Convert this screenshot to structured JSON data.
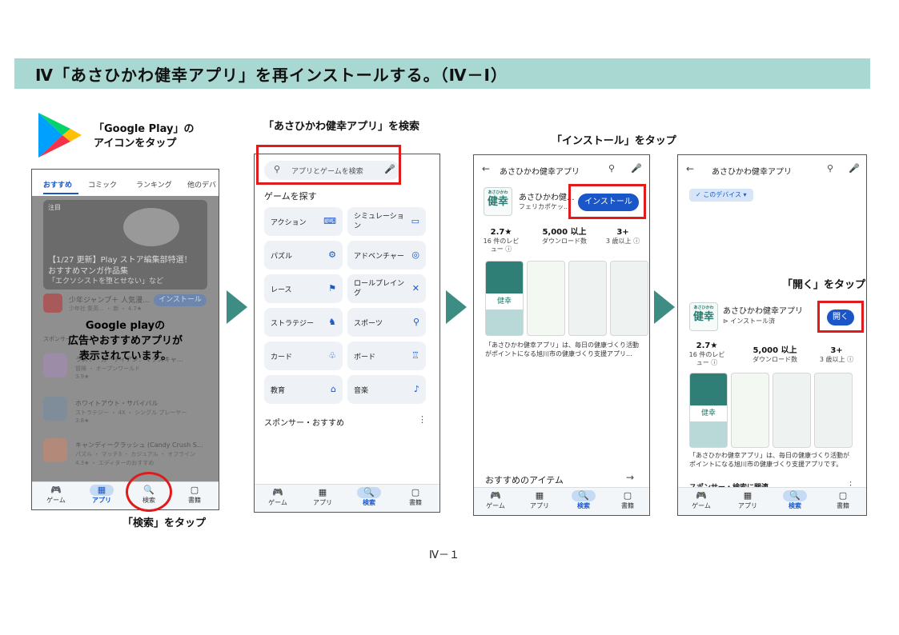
{
  "header": {
    "title": "Ⅳ「あさひかわ健幸アプリ」を再インストールする。（Ⅳ－Ⅰ）"
  },
  "captions": {
    "play_icon": "「Google Play」の",
    "play_icon2": "アイコンをタップ",
    "search_tap": "「検索」をタップ",
    "search_app": "「あさひかわ健幸アプリ」を検索",
    "install_tap": "「インストール」をタップ",
    "open_tap": "「開く」をタップ"
  },
  "colors": {
    "header_bg": "#a9d7d1",
    "arrow": "#3d8d85",
    "highlight": "#e01b1b",
    "primary": "#1a56c8"
  },
  "screen1": {
    "tabs": [
      "おすすめ",
      "コミック",
      "ランキング",
      "他のデバ"
    ],
    "overlay": [
      "Google playの",
      "広告やおすすめアプリが",
      "表示されています。"
    ],
    "featured_tag": "注目",
    "featured_title": "【1/27 更新】Play ストア編集部特選！",
    "featured_sub": "おすすめマンガ作品集",
    "featured_sub2": "「エクソシストを堕とせない」など",
    "row1_app": "少年ジャンプ＋ 人気漫...",
    "row1_meta": "少年社 集英... ・ 新 ・ 4.7★",
    "row1_btn": "インストール",
    "section": "スポンサー",
    "apps": [
      {
        "name": "ラスト・ガーディアン：マクスキャ...",
        "meta": "冒険 ・ オープンワールド",
        "rating": "3.9★"
      },
      {
        "name": "ホワイトアウト・サバイバル",
        "meta": "ストラテジー ・ 4X ・ シングル プレーヤー",
        "rating": "3.8★"
      },
      {
        "name": "キャンディークラッシュ (Candy Crush S...",
        "meta": "パズル ・ マッチ3 ・ カジュアル ・ オフライン",
        "rating": "4.3★ ・ エディターのおすすめ"
      }
    ],
    "nav": [
      {
        "icon": "🎮",
        "label": "ゲーム"
      },
      {
        "icon": "▦",
        "label": "アプリ"
      },
      {
        "icon": "🔍",
        "label": "検索"
      },
      {
        "icon": "▢",
        "label": "書籍"
      }
    ]
  },
  "screen2": {
    "search_placeholder": "アプリとゲームを検索",
    "section_title": "ゲームを探す",
    "categories": [
      {
        "label": "アクション",
        "icon": "⌨"
      },
      {
        "label": "シミュレーション",
        "icon": "▭"
      },
      {
        "label": "パズル",
        "icon": "⚙"
      },
      {
        "label": "アドベンチャー",
        "icon": "◎"
      },
      {
        "label": "レース",
        "icon": "⚑"
      },
      {
        "label": "ロールプレイング",
        "icon": "✕"
      },
      {
        "label": "ストラテジー",
        "icon": "♞"
      },
      {
        "label": "スポーツ",
        "icon": "⚲"
      },
      {
        "label": "カード",
        "icon": "♧"
      },
      {
        "label": "ボード",
        "icon": "♖"
      },
      {
        "label": "教育",
        "icon": "⌂"
      },
      {
        "label": "音楽",
        "icon": "♪"
      }
    ],
    "sponsored": "スポンサー・おすすめ",
    "nav": [
      {
        "icon": "🎮",
        "label": "ゲーム"
      },
      {
        "icon": "▦",
        "label": "アプリ"
      },
      {
        "icon": "🔍",
        "label": "検索"
      },
      {
        "icon": "▢",
        "label": "書籍"
      }
    ]
  },
  "screen3": {
    "title": "あさひかわ健幸アプリ",
    "app_name": "あさひかわ健...",
    "developer": "フェリカポケッ...",
    "install": "インストール",
    "rating": "2.7★",
    "reviews": "16 件のレビュー ⓘ",
    "downloads": "5,000 以上",
    "downloads_label": "ダウンロード数",
    "age": "3+",
    "age_label": "3 歳以上 ⓘ",
    "logo_small": "あさひかわ",
    "logo_big": "健幸",
    "shot_text": "健幸",
    "description": "「あさひかわ健幸アプリ」は、毎日の健康づくり活動がポイントになる旭川市の健康づくり支援アプリ...",
    "recommended": "おすすめのアイテム",
    "nav": [
      {
        "icon": "🎮",
        "label": "ゲーム"
      },
      {
        "icon": "▦",
        "label": "アプリ"
      },
      {
        "icon": "🔍",
        "label": "検索"
      },
      {
        "icon": "▢",
        "label": "書籍"
      }
    ]
  },
  "screen4": {
    "title": "あさひかわ健幸アプリ",
    "chip": "✓ このデバイス ▾",
    "app_name": "あさひかわ健幸アプリ",
    "installed": "⊳ インストール済",
    "open": "開く",
    "rating": "2.7★",
    "reviews": "16 件のレビュー ⓘ",
    "downloads": "5,000 以上",
    "downloads_label": "ダウンロード数",
    "age": "3+",
    "age_label": "3 歳以上 ⓘ",
    "logo_small": "あさひかわ",
    "logo_big": "健幸",
    "shot_text": "健幸",
    "description": "「あさひかわ健幸アプリ」は、毎日の健康づくり活動がポイントになる旭川市の健康づくり支援アプリです。",
    "sponsored": "スポンサー・検索に関連",
    "nav": [
      {
        "icon": "🎮",
        "label": "ゲーム"
      },
      {
        "icon": "▦",
        "label": "アプリ"
      },
      {
        "icon": "🔍",
        "label": "検索"
      },
      {
        "icon": "▢",
        "label": "書籍"
      }
    ]
  },
  "footer": {
    "page": "Ⅳ－１"
  }
}
